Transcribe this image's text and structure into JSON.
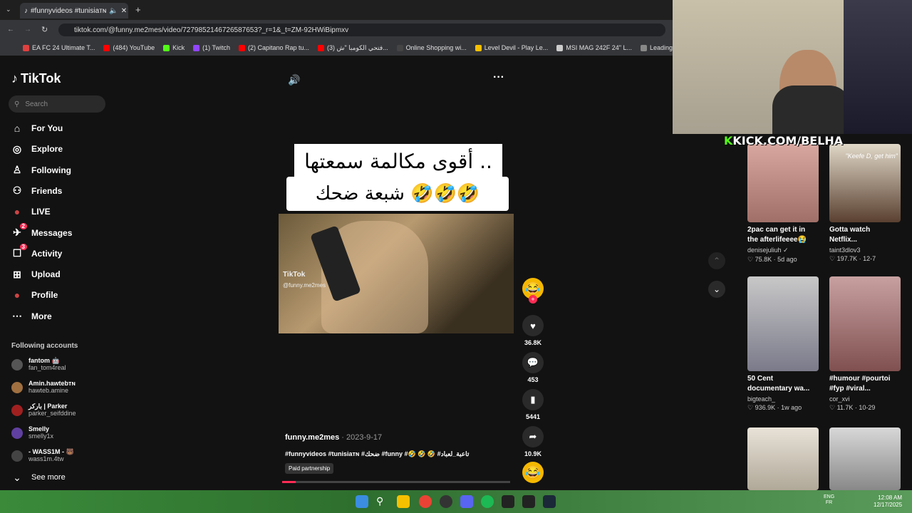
{
  "browser": {
    "tab_title": "#funnyvideos #tunisiaᴛɴ",
    "url": "tiktok.com/@funny.me2mes/video/7279852146726587653?_r=1&_t=ZM-92HWiBipmxv",
    "bookmarks": [
      "EA FC 24 Ultimate T...",
      "(484) YouTube",
      "Kick",
      "(1) Twitch",
      "(2) Capitano Rap tu...",
      "(3) فتحي الكومبا \"ش...",
      "Online Shopping wi...",
      "Level Devil - Play Le...",
      "MSI MAG 242F 24\" L...",
      "Leading Digital Stor..."
    ],
    "bookmark_colors": [
      "#e04040",
      "#ff0000",
      "#53fc18",
      "#9146ff",
      "#ff0000",
      "#ff0000",
      "#444444",
      "#f5c000",
      "#cccccc",
      "#888888"
    ]
  },
  "tiktok": {
    "brand": "TikTok",
    "search_placeholder": "Search",
    "nav": [
      {
        "label": "For You",
        "icon": "home-icon"
      },
      {
        "label": "Explore",
        "icon": "compass-icon"
      },
      {
        "label": "Following",
        "icon": "following-icon"
      },
      {
        "label": "Friends",
        "icon": "friends-icon"
      },
      {
        "label": "LIVE",
        "icon": "live-icon"
      },
      {
        "label": "Messages",
        "icon": "messages-icon",
        "badge": "2"
      },
      {
        "label": "Activity",
        "icon": "activity-icon",
        "badge": "3"
      },
      {
        "label": "Upload",
        "icon": "upload-icon"
      },
      {
        "label": "Profile",
        "icon": "profile-icon"
      },
      {
        "label": "More",
        "icon": "more-icon"
      }
    ],
    "following_heading": "Following accounts",
    "accounts": [
      {
        "name": "fantom 🤖",
        "user": "fan_tom4real"
      },
      {
        "name": "Amin.hawtebᴛɴ",
        "user": "hawteb.amine"
      },
      {
        "name": "باركر | Parker",
        "user": "parker_seifddine"
      },
      {
        "name": "Smelly",
        "user": "smelly1x"
      },
      {
        "name": "- WASS1M - 🐻",
        "user": "wass1m.4tw"
      }
    ],
    "see_more": "See more"
  },
  "video": {
    "caption_line1": "أقوى مكالمة سمعتها ..",
    "caption_line2": "شبعة ضحك 🤣🤣🤣",
    "watermark": "TikTok",
    "watermark_user": "@funny.me2mes",
    "username": "funny.me2mes",
    "date": "2023-9-17",
    "tags": "#funnyvideos #tunisiaᴛɴ #ضحك #funny #🤣 🤣 🤣 #تاعبة_لعباد",
    "paid": "Paid partnership",
    "progress": 0.06,
    "likes": "36.8K",
    "comments": "453",
    "saves": "5441",
    "shares": "10.9K"
  },
  "recommended": [
    {
      "title": "2pac can get it in the afterlifeeee😭",
      "user": "denisejuliuh ✓",
      "stats": "♡ 75.8K · 5d ago",
      "thumb_text": ""
    },
    {
      "title": "Gotta watch Netflix...",
      "user": "taint3dlov3",
      "stats": "♡ 197.7K · 12-7",
      "thumb_text": "\"Keefe D, get him\""
    },
    {
      "title": "50 Cent documentary wa...",
      "user": "bigteach_",
      "stats": "♡ 936.9K · 1w ago",
      "thumb_text": ""
    },
    {
      "title": "#humour #pourtoi #fyp #viral...",
      "user": "cor_xvi",
      "stats": "♡ 11.7K · 10-29",
      "thumb_text": ""
    }
  ],
  "overlay": {
    "kick": "KICK.COM/BELHA"
  },
  "taskbar": {
    "lang1": "ENG",
    "lang2": "FR",
    "time": "12:08 AM",
    "date": "12/17/2025"
  }
}
